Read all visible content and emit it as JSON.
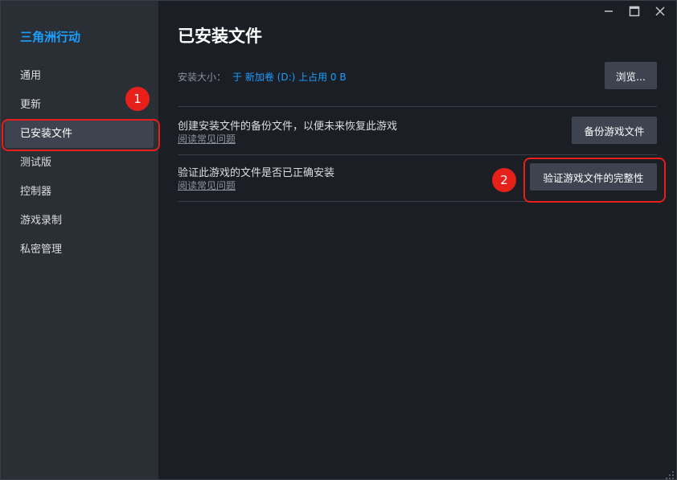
{
  "sidebar": {
    "game_title": "三角洲行动",
    "items": [
      {
        "label": "通用"
      },
      {
        "label": "更新"
      },
      {
        "label": "已安装文件"
      },
      {
        "label": "测试版"
      },
      {
        "label": "控制器"
      },
      {
        "label": "游戏录制"
      },
      {
        "label": "私密管理"
      }
    ]
  },
  "main": {
    "title": "已安装文件",
    "install_size_label": "安装大小：",
    "install_size_value": "于 新加卷 (D:) 上占用 0 B",
    "browse_button": "浏览...",
    "backup": {
      "description": "创建安装文件的备份文件，以便未来恢复此游戏",
      "faq_link": "阅读常见问题",
      "button": "备份游戏文件"
    },
    "verify": {
      "description": "验证此游戏的文件是否已正确安装",
      "faq_link": "阅读常见问题",
      "button": "验证游戏文件的完整性"
    }
  },
  "annotations": [
    {
      "number": "1"
    },
    {
      "number": "2"
    }
  ],
  "colors": {
    "accent": "#1a9fff",
    "annotation": "#e8201c",
    "sidebar_bg": "#2a2e35",
    "main_bg": "#1b1e24",
    "button_bg": "#3d4450"
  },
  "icons": [
    "minimize-icon",
    "maximize-icon",
    "close-icon",
    "resize-grip-icon"
  ]
}
